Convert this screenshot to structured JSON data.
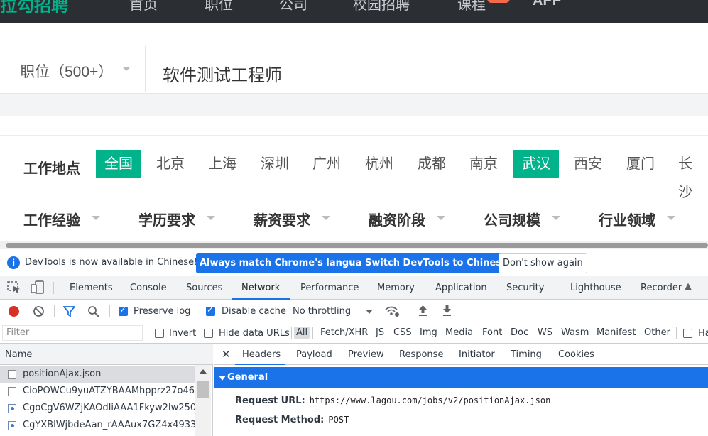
{
  "site": {
    "logo": "拉勾招聘",
    "nav": [
      "首页",
      "职位",
      "公司",
      "校园招聘",
      "课程",
      "APP"
    ]
  },
  "search": {
    "type_label": "职位（500+）",
    "query": "软件测试工程师"
  },
  "filters": {
    "location_label": "工作地点",
    "cities": [
      "全国",
      "北京",
      "上海",
      "深圳",
      "广州",
      "杭州",
      "成都",
      "南京",
      "武汉",
      "西安",
      "厦门",
      "长沙"
    ],
    "selected_cities": [
      "全国",
      "武汉"
    ],
    "dropdowns": [
      "工作经验",
      "学历要求",
      "薪资要求",
      "融资阶段",
      "公司规模",
      "行业领域"
    ]
  },
  "devtools": {
    "infobar": {
      "message": "DevTools is now available in Chinese!",
      "btn_match": "Always match Chrome's language",
      "btn_switch": "Switch DevTools to Chinese",
      "btn_dismiss": "Don't show again"
    },
    "tabs": [
      "Elements",
      "Console",
      "Sources",
      "Network",
      "Performance",
      "Memory",
      "Application",
      "Security",
      "Lighthouse",
      "Recorder"
    ],
    "active_tab": "Network",
    "network_toolbar": {
      "preserve_log": "Preserve log",
      "disable_cache": "Disable cache",
      "throttling": "No throttling"
    },
    "filter_bar": {
      "placeholder": "Filter",
      "invert": "Invert",
      "hide_data_urls": "Hide data URLs",
      "types": [
        "All",
        "Fetch/XHR",
        "JS",
        "CSS",
        "Img",
        "Media",
        "Font",
        "Doc",
        "WS",
        "Wasm",
        "Manifest",
        "Other"
      ],
      "has_blocked": "Ha"
    },
    "requests": {
      "header": "Name",
      "rows": [
        "positionAjax.json",
        "CioPOWCu9yuATZYBAAMhpprz27o46",
        "CgoCgV6WZjKAOdIiAAA1Fkyw2Iw250",
        "CgYXBlWjbdeAan_rAAAux7GZ4x4933."
      ]
    },
    "detail": {
      "tabs": [
        "Headers",
        "Payload",
        "Preview",
        "Response",
        "Initiator",
        "Timing",
        "Cookies"
      ],
      "active_tab": "Headers",
      "section": "General",
      "request_url_label": "Request URL:",
      "request_url": "https://www.lagou.com/jobs/v2/positionAjax.json",
      "request_method_label": "Request Method:",
      "request_method": "POST"
    }
  },
  "colors": {
    "brand_green": "#00b38a",
    "devtools_blue": "#1a73e8",
    "nav_dark": "#2b2e33"
  }
}
